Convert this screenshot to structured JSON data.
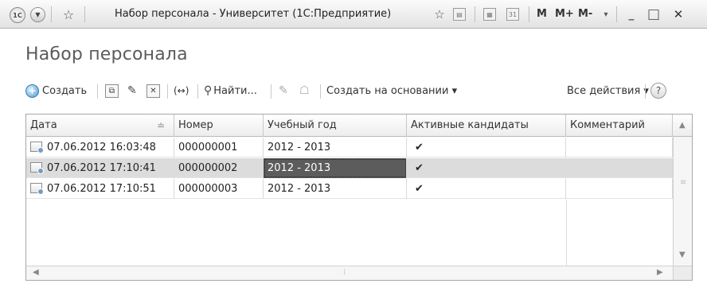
{
  "window": {
    "title": "Набор персонала - Университет  (1С:Предприятие)",
    "logo_icon": "1c-logo-icon",
    "menu_icon": "chevron-down-icon",
    "m_label": "M",
    "mplus_label": "M+",
    "mminus_label": "M-",
    "minimize_label": "_",
    "maximize_label": "□",
    "close_label": "✕"
  },
  "form": {
    "title": "Набор персонала"
  },
  "toolbar": {
    "create_label": "Создать",
    "find_label": "Найти...",
    "create_based_label": "Создать на основании ▾",
    "all_actions_label": "Все действия ▾",
    "help_label": "?"
  },
  "table": {
    "columns": [
      "Дата",
      "Номер",
      "Учебный год",
      "Активные кандидаты",
      "Комментарий"
    ],
    "rows": [
      {
        "date": "07.06.2012 16:03:48",
        "number": "000000001",
        "year": "2012 - 2013",
        "active": "✔",
        "comment": ""
      },
      {
        "date": "07.06.2012 17:10:41",
        "number": "000000002",
        "year": "2012 - 2013",
        "active": "✔",
        "comment": ""
      },
      {
        "date": "07.06.2012 17:10:51",
        "number": "000000003",
        "year": "2012 - 2013",
        "active": "✔",
        "comment": ""
      }
    ],
    "selected_row": 1,
    "sort_indicator": "≐"
  }
}
